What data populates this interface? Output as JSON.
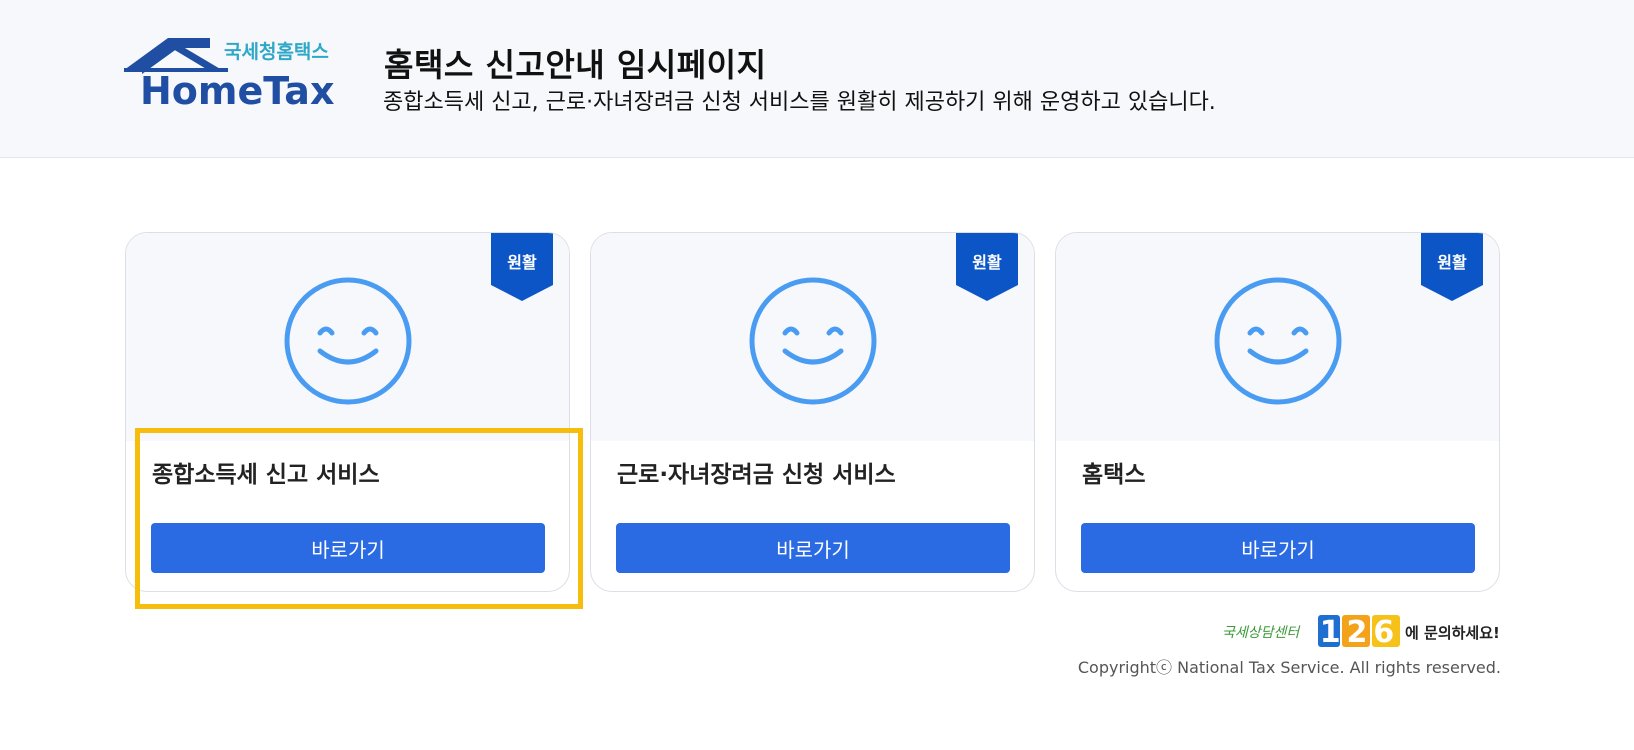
{
  "header": {
    "logo_text_small": "국세청홈택스",
    "logo_text_main": "HomeTax",
    "title": "홈택스 신고안내 임시페이지",
    "subtitle": "종합소득세 신고, 근로·자녀장려금 신청 서비스를 원활히 제공하기 위해 운영하고 있습니다."
  },
  "cards": [
    {
      "status": "원활",
      "title": "종합소득세 신고 서비스",
      "button_label": "바로가기",
      "icon": "smiley-face-icon"
    },
    {
      "status": "원활",
      "title": "근로·자녀장려금 신청 서비스",
      "button_label": "바로가기",
      "icon": "smiley-face-icon"
    },
    {
      "status": "원활",
      "title": "홈택스",
      "button_label": "바로가기",
      "icon": "smiley-face-icon"
    }
  ],
  "footer": {
    "consult_label": "국세상담센터",
    "consult_number": "126",
    "consult_suffix": "에 문의하세요!",
    "copyright": "Copyrightⓒ National Tax Service. All rights reserved."
  },
  "colors": {
    "primary": "#2a6be4",
    "ribbon": "#0c55c7",
    "smiley": "#4a9cf2",
    "highlight": "#f7bd0c",
    "header_bg": "#f7f8fc",
    "logo_blue": "#1f4ea3",
    "logo_teal": "#2fa8c8"
  }
}
